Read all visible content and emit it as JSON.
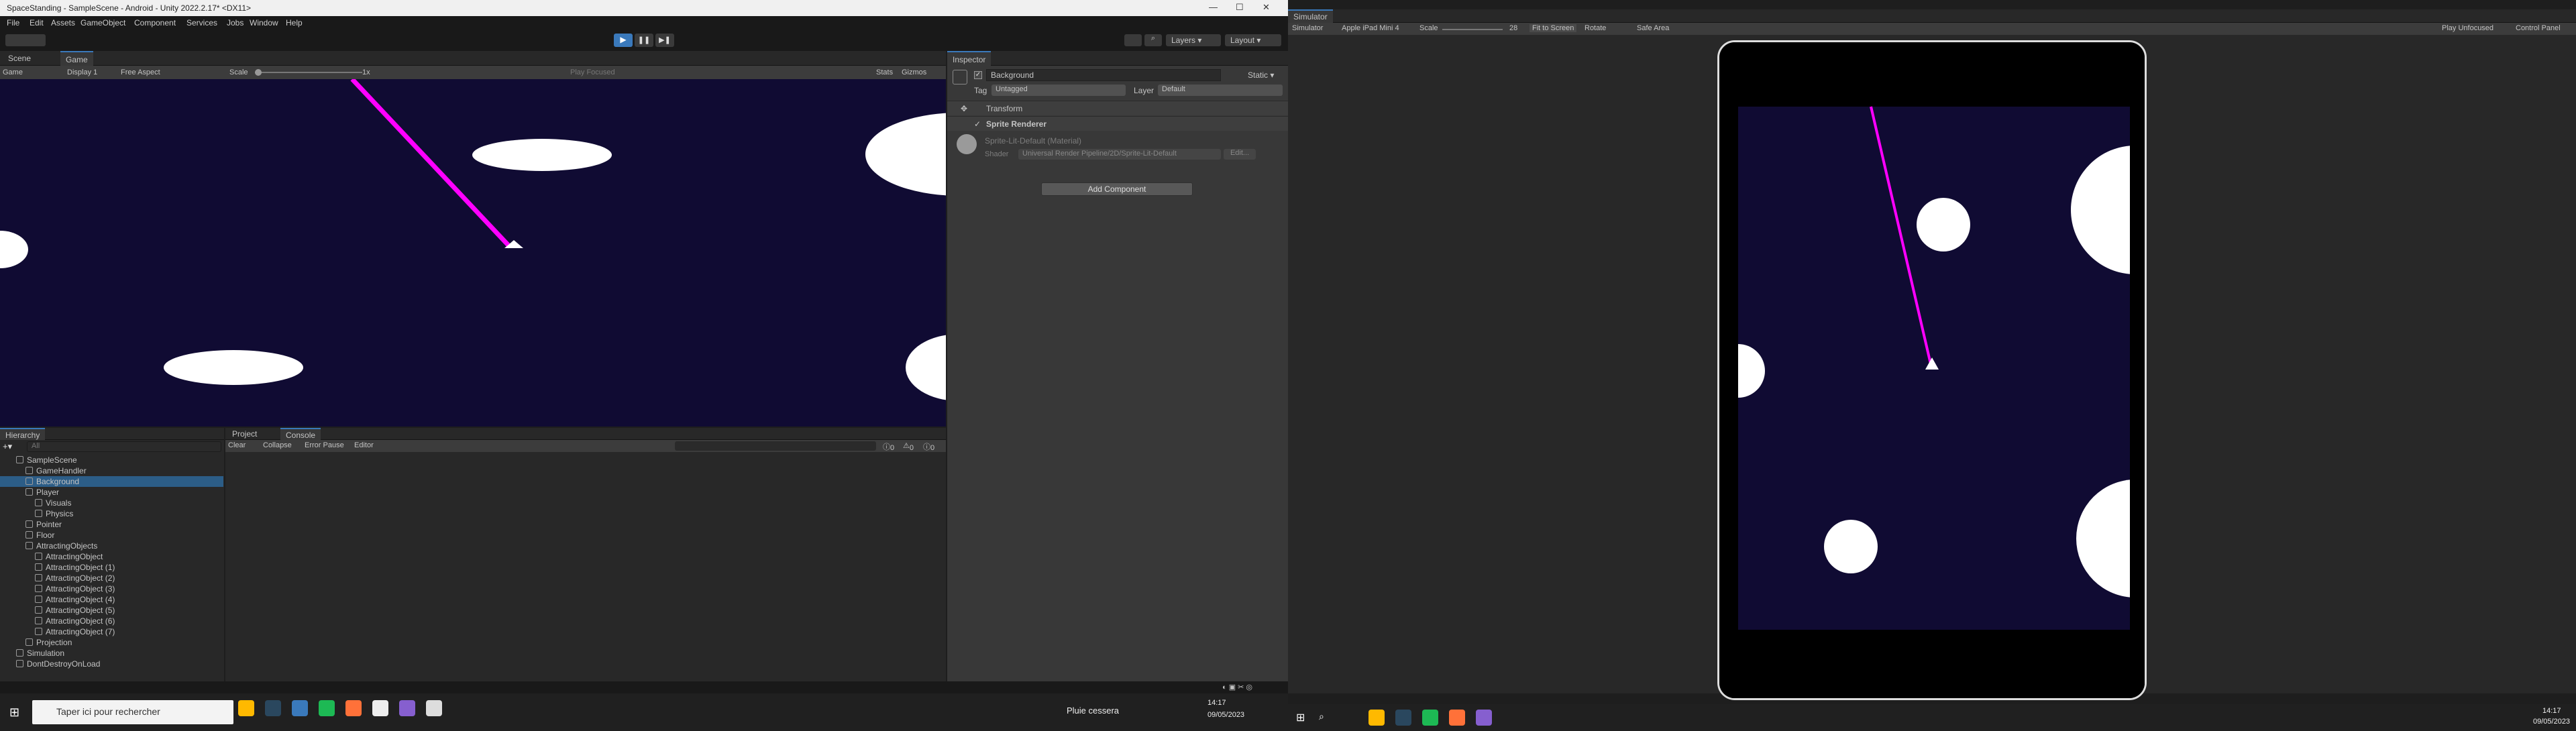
{
  "unity": {
    "title": "SpaceStanding - SampleScene - Android - Unity 2022.2.17* <DX11>",
    "menu": [
      "File",
      "Edit",
      "Assets",
      "GameObject",
      "Component",
      "Services",
      "Jobs",
      "Window",
      "Help"
    ],
    "toolbar_right": {
      "layers": "Layers",
      "layout": "Layout"
    },
    "scene_tabs": {
      "scene": "Scene",
      "game": "Game"
    },
    "game_bar": {
      "mode": "Game",
      "display": "Display 1",
      "aspect": "Free Aspect",
      "scale_label": "Scale",
      "scale_value": "1x",
      "play_focused": "Play Focused",
      "stats": "Stats",
      "gizmos": "Gizmos"
    },
    "inspector": {
      "tab": "Inspector",
      "object_name": "Background",
      "static": "Static",
      "tag_label": "Tag",
      "tag_value": "Untagged",
      "layer_label": "Layer",
      "layer_value": "Default",
      "components": [
        "Transform",
        "Sprite Renderer"
      ],
      "material_name": "Sprite-Lit-Default (Material)",
      "shader_label": "Shader",
      "shader_value": "Universal Render Pipeline/2D/Sprite-Lit-Default",
      "edit": "Edit...",
      "add_component": "Add Component"
    },
    "hierarchy": {
      "tab": "Hierarchy",
      "search_placeholder": "All",
      "rows": [
        {
          "label": "SampleScene",
          "indent": 0,
          "type": "scene"
        },
        {
          "label": "GameHandler",
          "indent": 1,
          "type": "obj"
        },
        {
          "label": "Background",
          "indent": 1,
          "type": "obj",
          "selected": true
        },
        {
          "label": "Player",
          "indent": 1,
          "type": "obj"
        },
        {
          "label": "Visuals",
          "indent": 2,
          "type": "obj"
        },
        {
          "label": "Physics",
          "indent": 2,
          "type": "obj"
        },
        {
          "label": "Pointer",
          "indent": 1,
          "type": "obj"
        },
        {
          "label": "Floor",
          "indent": 1,
          "type": "obj"
        },
        {
          "label": "AttractingObjects",
          "indent": 1,
          "type": "obj"
        },
        {
          "label": "AttractingObject",
          "indent": 2,
          "type": "obj"
        },
        {
          "label": "AttractingObject (1)",
          "indent": 2,
          "type": "obj"
        },
        {
          "label": "AttractingObject (2)",
          "indent": 2,
          "type": "obj"
        },
        {
          "label": "AttractingObject (3)",
          "indent": 2,
          "type": "obj"
        },
        {
          "label": "AttractingObject (4)",
          "indent": 2,
          "type": "obj"
        },
        {
          "label": "AttractingObject (5)",
          "indent": 2,
          "type": "obj"
        },
        {
          "label": "AttractingObject (6)",
          "indent": 2,
          "type": "obj"
        },
        {
          "label": "AttractingObject (7)",
          "indent": 2,
          "type": "obj"
        },
        {
          "label": "Projection",
          "indent": 1,
          "type": "obj"
        },
        {
          "label": "Simulation",
          "indent": 0,
          "type": "scene"
        },
        {
          "label": "DontDestroyOnLoad",
          "indent": 0,
          "type": "scene"
        }
      ]
    },
    "console": {
      "project_tab": "Project",
      "console_tab": "Console",
      "clear": "Clear",
      "collapse": "Collapse",
      "error_pause": "Error Pause",
      "editor": "Editor",
      "counts": [
        "0",
        "0",
        "0"
      ]
    }
  },
  "simulator": {
    "tab": "Simulator",
    "mode": "Simulator",
    "device": "Apple iPad Mini 4",
    "scale_label": "Scale",
    "scale_value": "28",
    "fit": "Fit to Screen",
    "rotate": "Rotate",
    "safe_area": "Safe Area",
    "play_mode": "Play Unfocused",
    "control_panel": "Control Panel"
  },
  "taskbar_left": {
    "search_placeholder": "Taper ici pour rechercher",
    "weather": "Pluie cessera",
    "time": "14:17",
    "date": "09/05/2023"
  },
  "taskbar_right": {
    "time": "14:17",
    "date": "09/05/2023"
  },
  "colors": {
    "space": "#100b33",
    "magenta": "#ff00ff",
    "accent": "#3a79bb"
  }
}
